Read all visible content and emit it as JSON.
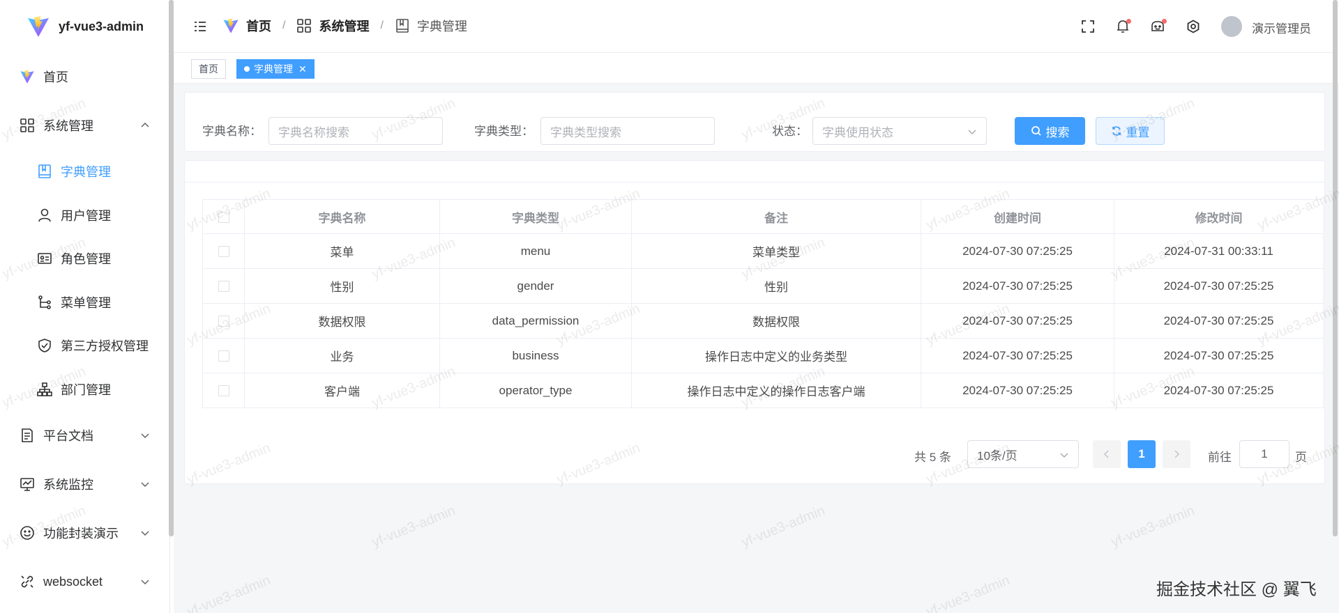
{
  "app": {
    "title": "yf-vue3-admin"
  },
  "sidebar": {
    "items": [
      {
        "label": "首页",
        "icon": "vite-logo-icon"
      },
      {
        "label": "系统管理",
        "icon": "grid-icon"
      },
      {
        "label": "字典管理",
        "icon": "dictionary-icon"
      },
      {
        "label": "用户管理",
        "icon": "user-icon"
      },
      {
        "label": "角色管理",
        "icon": "id-card-icon"
      },
      {
        "label": "菜单管理",
        "icon": "tree-icon"
      },
      {
        "label": "第三方授权管理",
        "icon": "shield-icon"
      },
      {
        "label": "部门管理",
        "icon": "org-chart-icon"
      },
      {
        "label": "平台文档",
        "icon": "document-icon"
      },
      {
        "label": "系统监控",
        "icon": "monitor-icon"
      },
      {
        "label": "功能封装演示",
        "icon": "smile-icon"
      },
      {
        "label": "websocket",
        "icon": "link-icon"
      }
    ]
  },
  "header": {
    "breadcrumb": [
      "首页",
      "系统管理",
      "字典管理"
    ],
    "separator": "/",
    "user_name": "演示管理员"
  },
  "tabs": [
    {
      "label": "首页"
    },
    {
      "label": "字典管理",
      "close": "✕"
    }
  ],
  "search": {
    "name_label": "字典名称：",
    "name_placeholder": "字典名称搜索",
    "type_label": "字典类型：",
    "type_placeholder": "字典类型搜索",
    "status_label": "状态：",
    "status_placeholder": "字典使用状态",
    "search_button": "搜索",
    "reset_button": "重置"
  },
  "table": {
    "columns": [
      "字典名称",
      "字典类型",
      "备注",
      "创建时间",
      "修改时间"
    ],
    "rows": [
      [
        "菜单",
        "menu",
        "菜单类型",
        "2024-07-30 07:25:25",
        "2024-07-31 00:33:11"
      ],
      [
        "性别",
        "gender",
        "性别",
        "2024-07-30 07:25:25",
        "2024-07-30 07:25:25"
      ],
      [
        "数据权限",
        "data_permission",
        "数据权限",
        "2024-07-30 07:25:25",
        "2024-07-30 07:25:25"
      ],
      [
        "业务",
        "business",
        "操作日志中定义的业务类型",
        "2024-07-30 07:25:25",
        "2024-07-30 07:25:25"
      ],
      [
        "客户端",
        "operator_type",
        "操作日志中定义的操作日志客户端",
        "2024-07-30 07:25:25",
        "2024-07-30 07:25:25"
      ]
    ]
  },
  "pagination": {
    "total": "共 5 条",
    "page_size": "10条/页",
    "current_page": "1",
    "goto_label": "前往",
    "goto_value": "1",
    "page_suffix": "页"
  },
  "watermark_text": "yf-vue3-admin",
  "footer_mark": "掘金技术社区 @ 翼飞",
  "colors": {
    "accent": "#409eff",
    "badge": "#f56c6c"
  }
}
